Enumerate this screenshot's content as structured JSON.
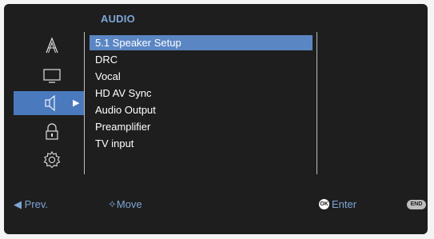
{
  "header": {
    "title": "AUDIO"
  },
  "sidebar": {
    "items": [
      {
        "icon": "font-icon"
      },
      {
        "icon": "tv-screen-icon"
      },
      {
        "icon": "speaker-icon",
        "selected": true
      },
      {
        "icon": "lock-icon"
      },
      {
        "icon": "gear-icon"
      }
    ]
  },
  "menu": {
    "items": [
      {
        "label": "5.1 Speaker Setup",
        "selected": true
      },
      {
        "label": "DRC"
      },
      {
        "label": "Vocal"
      },
      {
        "label": "HD AV Sync"
      },
      {
        "label": "Audio Output"
      },
      {
        "label": "Preamplifier"
      },
      {
        "label": "TV input"
      }
    ]
  },
  "footer": {
    "prev_label": "◀ Prev.",
    "move_label": "✧Move",
    "ok_badge": "OK",
    "enter_label": "Enter",
    "end_badge": "END"
  },
  "colors": {
    "background": "#1e1e1e",
    "title": "#7ea5d6",
    "menu_highlight": "#5b86c4",
    "sidebar_highlight": "#4a79bd"
  }
}
